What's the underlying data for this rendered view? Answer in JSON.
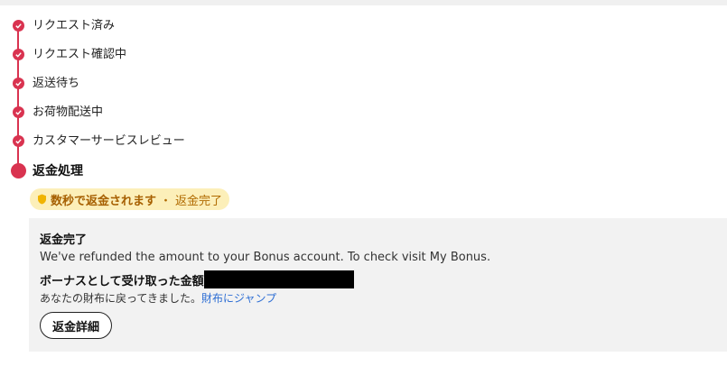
{
  "timeline": {
    "steps": [
      {
        "label": "リクエスト済み",
        "status": "done"
      },
      {
        "label": "リクエスト確認中",
        "status": "done"
      },
      {
        "label": "返送待ち",
        "status": "done"
      },
      {
        "label": "お荷物配送中",
        "status": "done"
      },
      {
        "label": "カスタマーサービスレビュー",
        "status": "done"
      }
    ],
    "current": {
      "label": "返金処理",
      "status": "current"
    }
  },
  "badge": {
    "icon": "shield-icon",
    "bold_text": "数秒で返金されます",
    "separator": "・",
    "status_text": "返金完了"
  },
  "refund_panel": {
    "title": "返金完了",
    "message": "We've refunded the amount to your Bonus account. To check visit My Bonus.",
    "amount_label": "ボーナスとして受け取った金額：",
    "back_text": "あなたの財布に戻ってきました。",
    "wallet_link": "財布にジャンプ",
    "details_button": "返金詳細"
  },
  "colors": {
    "accent": "#d93350",
    "badge_bg": "#fcefb9",
    "link": "#2f6fd4",
    "panel_bg": "#f2f2f2"
  }
}
